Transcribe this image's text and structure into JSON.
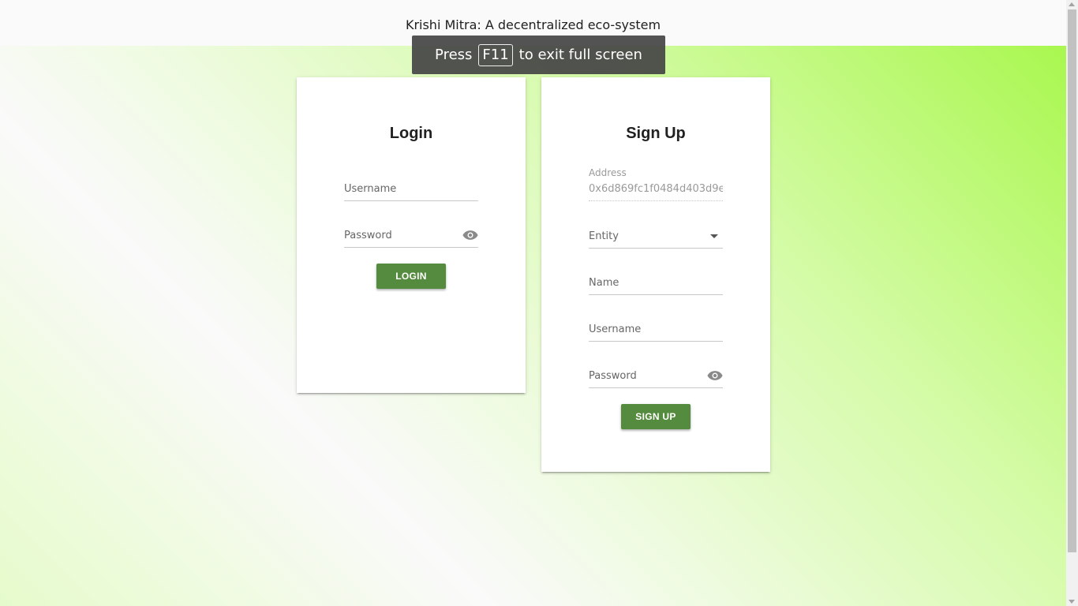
{
  "app": {
    "title": "Krishi Mitra: A decentralized eco-system"
  },
  "toast": {
    "prefix": "Press",
    "key": "F11",
    "suffix": "to exit full screen"
  },
  "login": {
    "title": "Login",
    "username_label": "Username",
    "password_label": "Password",
    "button_label": "LOGIN"
  },
  "signup": {
    "title": "Sign Up",
    "address_label": "Address",
    "address_value": "0x6d869fc1f0484d403d9e",
    "entity_label": "Entity",
    "name_label": "Name",
    "username_label": "Username",
    "password_label": "Password",
    "button_label": "SIGN UP"
  },
  "colors": {
    "primary_button": "#558b3e",
    "gradient_accent": "#a9f74f"
  }
}
